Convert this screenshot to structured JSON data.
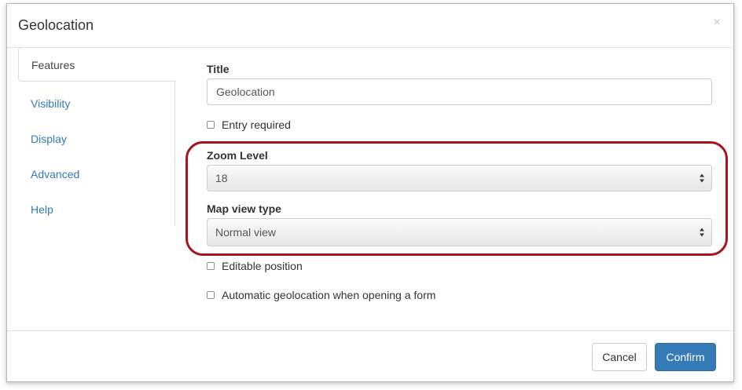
{
  "dialog": {
    "title": "Geolocation",
    "close_symbol": "×"
  },
  "nav": {
    "items": [
      {
        "label": "Features",
        "active": true
      },
      {
        "label": "Visibility",
        "active": false
      },
      {
        "label": "Display",
        "active": false
      },
      {
        "label": "Advanced",
        "active": false
      },
      {
        "label": "Help",
        "active": false
      }
    ]
  },
  "form": {
    "title_label": "Title",
    "title_value": "Geolocation",
    "entry_required_label": "Entry required",
    "entry_required_checked": false,
    "zoom_label": "Zoom Level",
    "zoom_value": "18",
    "map_view_label": "Map view type",
    "map_view_value": "Normal view",
    "editable_position_label": "Editable position",
    "editable_position_checked": false,
    "auto_geolocation_label": "Automatic geolocation when opening a form",
    "auto_geolocation_checked": false
  },
  "footer": {
    "cancel_label": "Cancel",
    "confirm_label": "Confirm"
  },
  "colors": {
    "accent": "#337ab7",
    "highlight": "#a8141c"
  }
}
